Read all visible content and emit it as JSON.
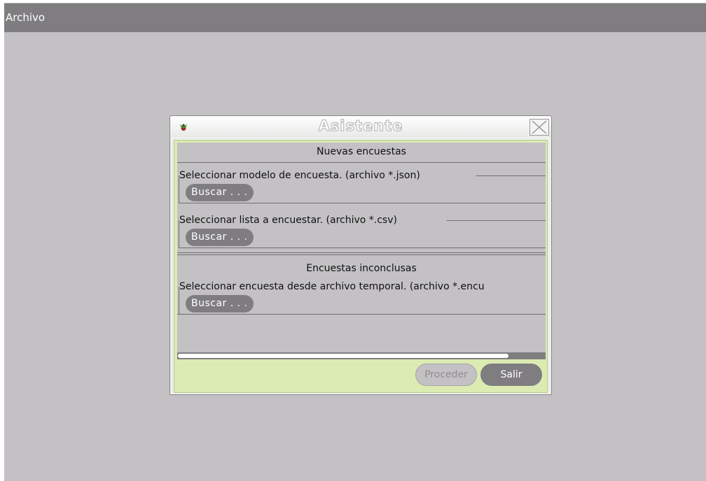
{
  "menubar": {
    "items": [
      "Archivo"
    ]
  },
  "dialog": {
    "title": "Asistente",
    "sections": {
      "new_surveys": {
        "heading": "Nuevas encuestas",
        "model_group": {
          "label": "Seleccionar modelo de encuesta. (archivo *.json)",
          "button": "Buscar . . ."
        },
        "list_group": {
          "label": "Seleccionar lista a encuestar. (archivo *.csv)",
          "button": "Buscar . . ."
        }
      },
      "unfinished_surveys": {
        "heading": "Encuestas inconclusas",
        "temp_group": {
          "label": "Seleccionar encuesta desde archivo temporal. (archivo *.encu",
          "button": "Buscar . . ."
        }
      }
    },
    "scrollbar": {
      "position_fraction": 0.0,
      "visible_fraction": 0.9
    },
    "buttons": {
      "proceed": "Proceder",
      "exit": "Salir"
    }
  },
  "colors": {
    "background": "#c3c1c4",
    "menubar": "#7f7d80",
    "dialog_frame": "#dcebb2",
    "button": "#7f7d80",
    "button_text": "#ffffff"
  },
  "icons": {
    "app": "app-bug-icon",
    "close": "close-icon"
  }
}
